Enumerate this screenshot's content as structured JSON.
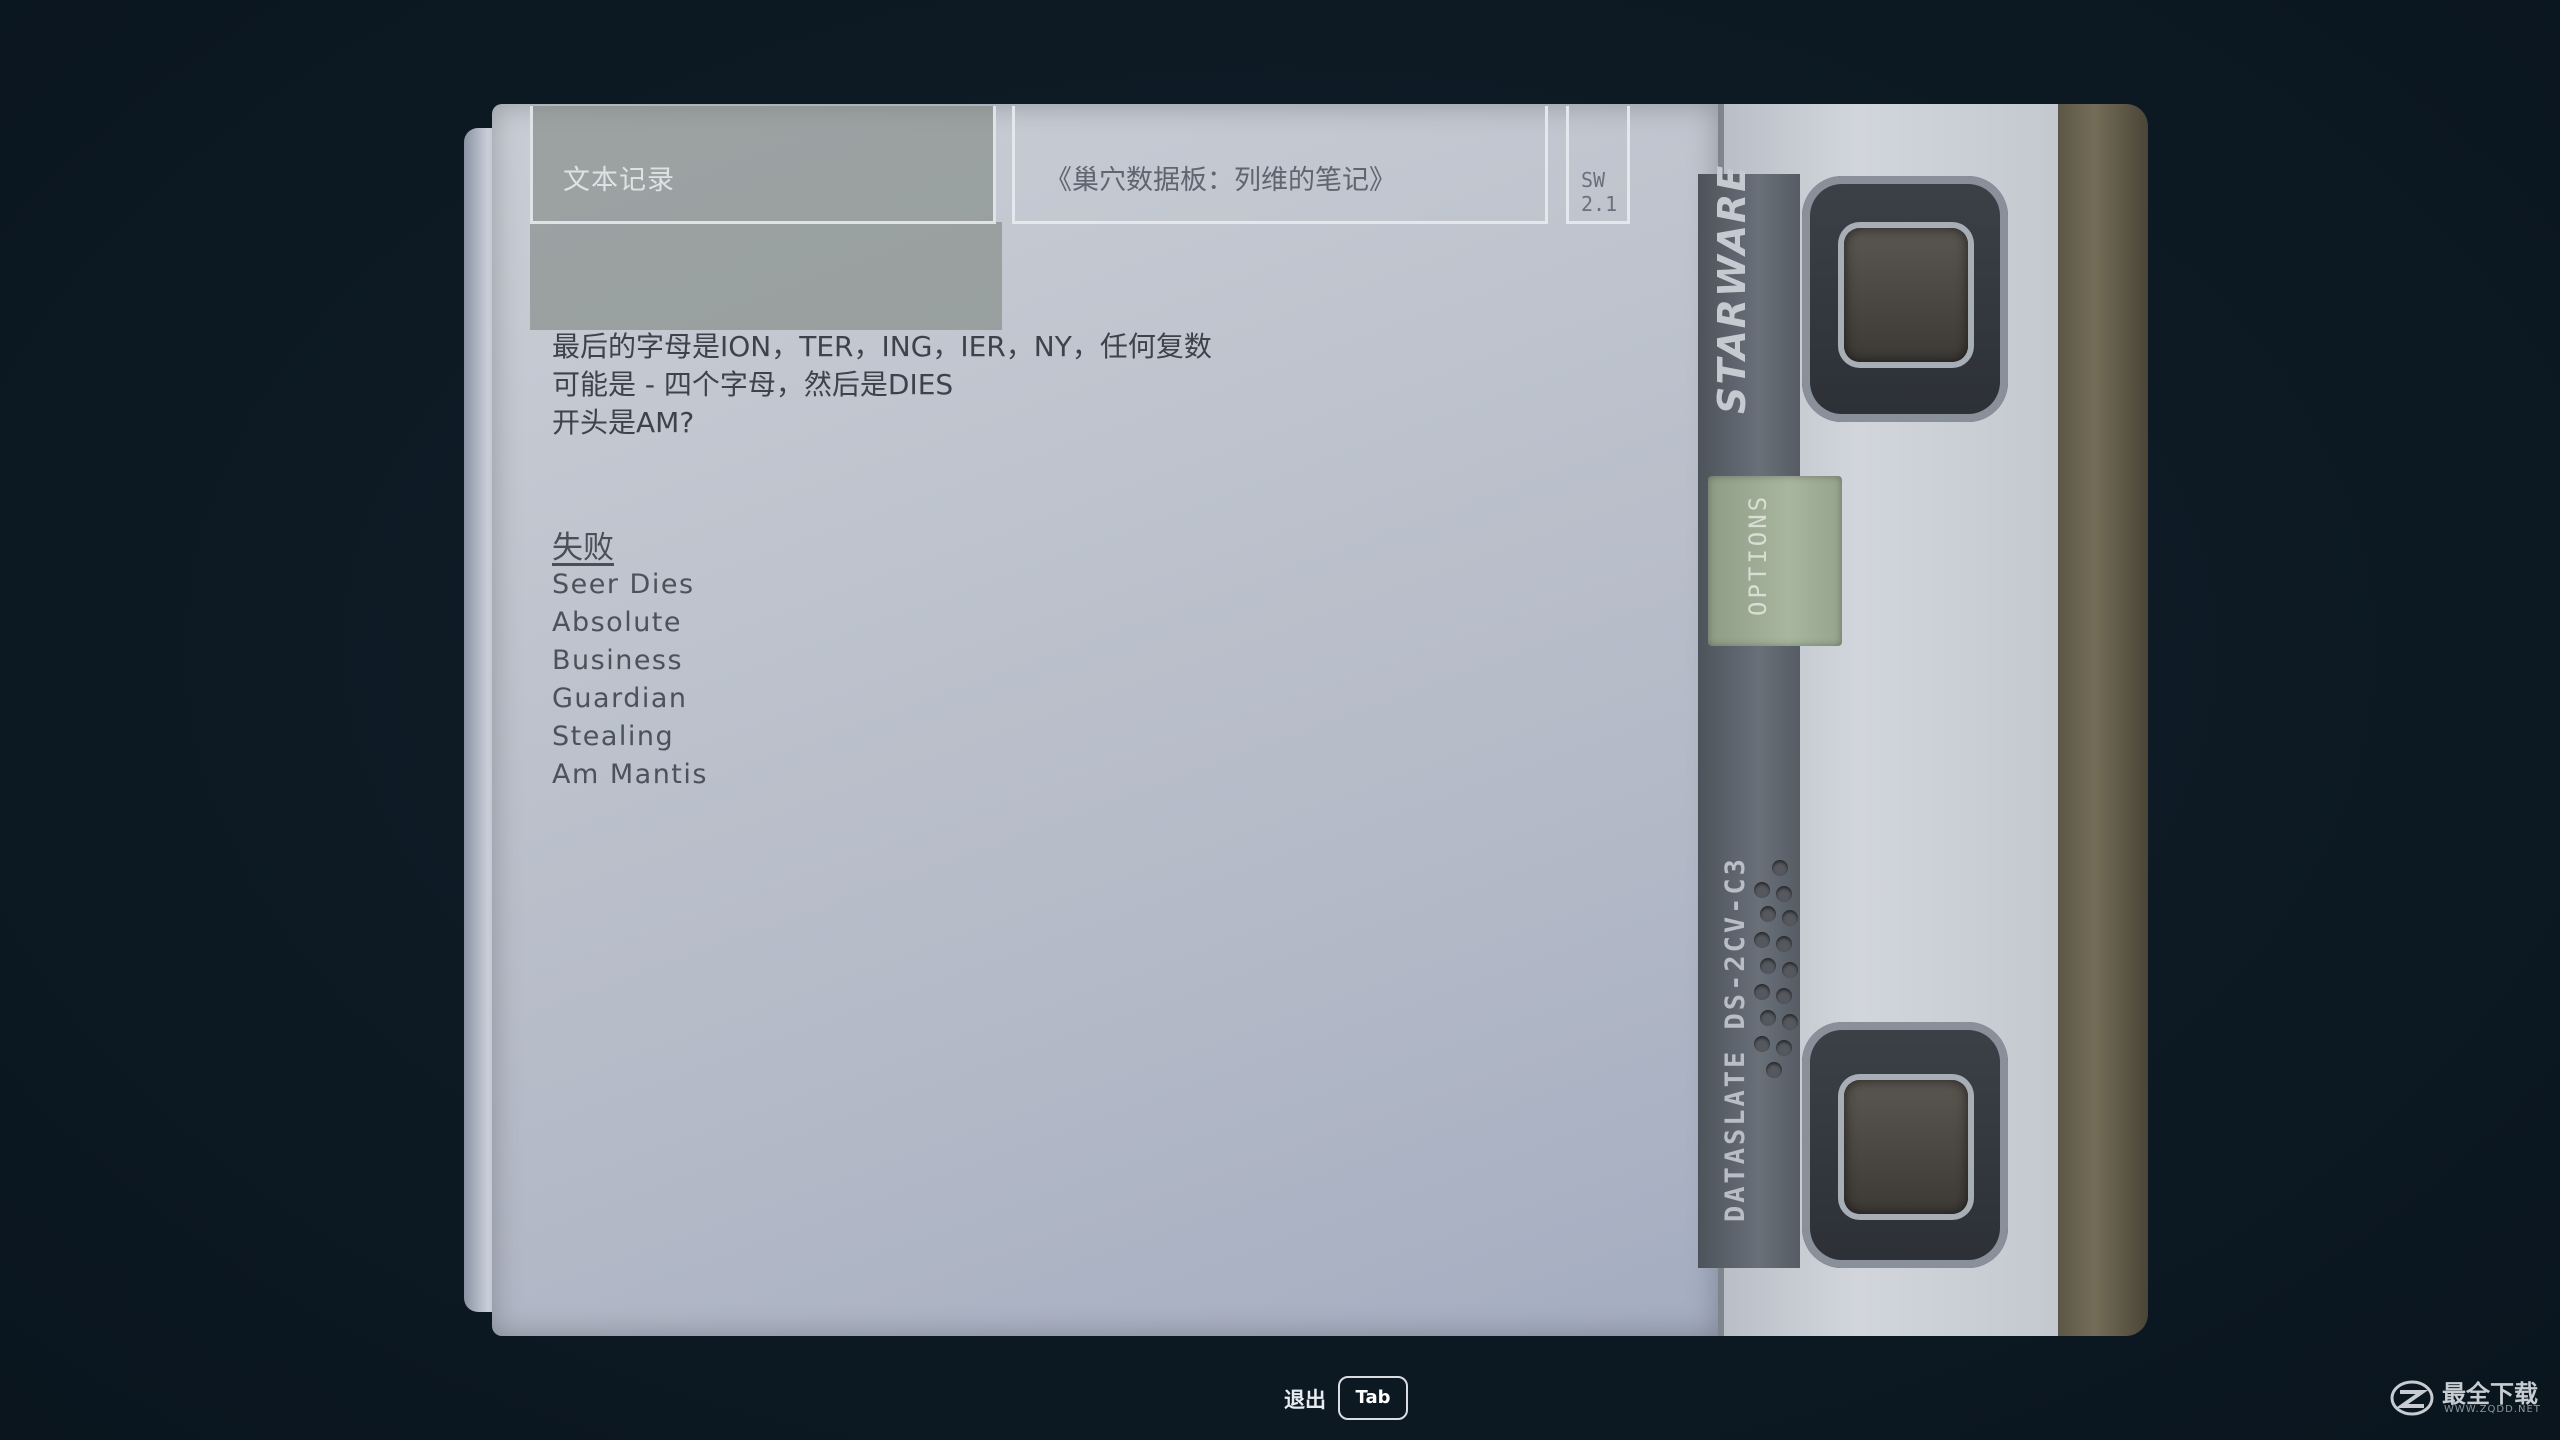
{
  "header": {
    "tab_label": "文本记录",
    "document_title": "《巢穴数据板：列维的笔记》",
    "version_line1": "SW",
    "version_line2": "2.1"
  },
  "note": {
    "lines": [
      "最后的字母是ION，TER，ING，IER，NY，任何复数",
      "可能是 - 四个字母，然后是DIES",
      "开头是AM?"
    ],
    "failed_heading": "失败",
    "failed_items": [
      "Seer Dies",
      "Absolute",
      "Business",
      "Guardian",
      "Stealing",
      "Am Mantis"
    ]
  },
  "device": {
    "brand": "STARWARE",
    "options_label": "OPTIONS",
    "model": "DATASLATE DS-2CV-C3"
  },
  "footer": {
    "exit_label": "退出",
    "exit_key": "Tab"
  },
  "watermark": {
    "text": "最全下载",
    "sub": "WWW.ZQDD.NET"
  }
}
